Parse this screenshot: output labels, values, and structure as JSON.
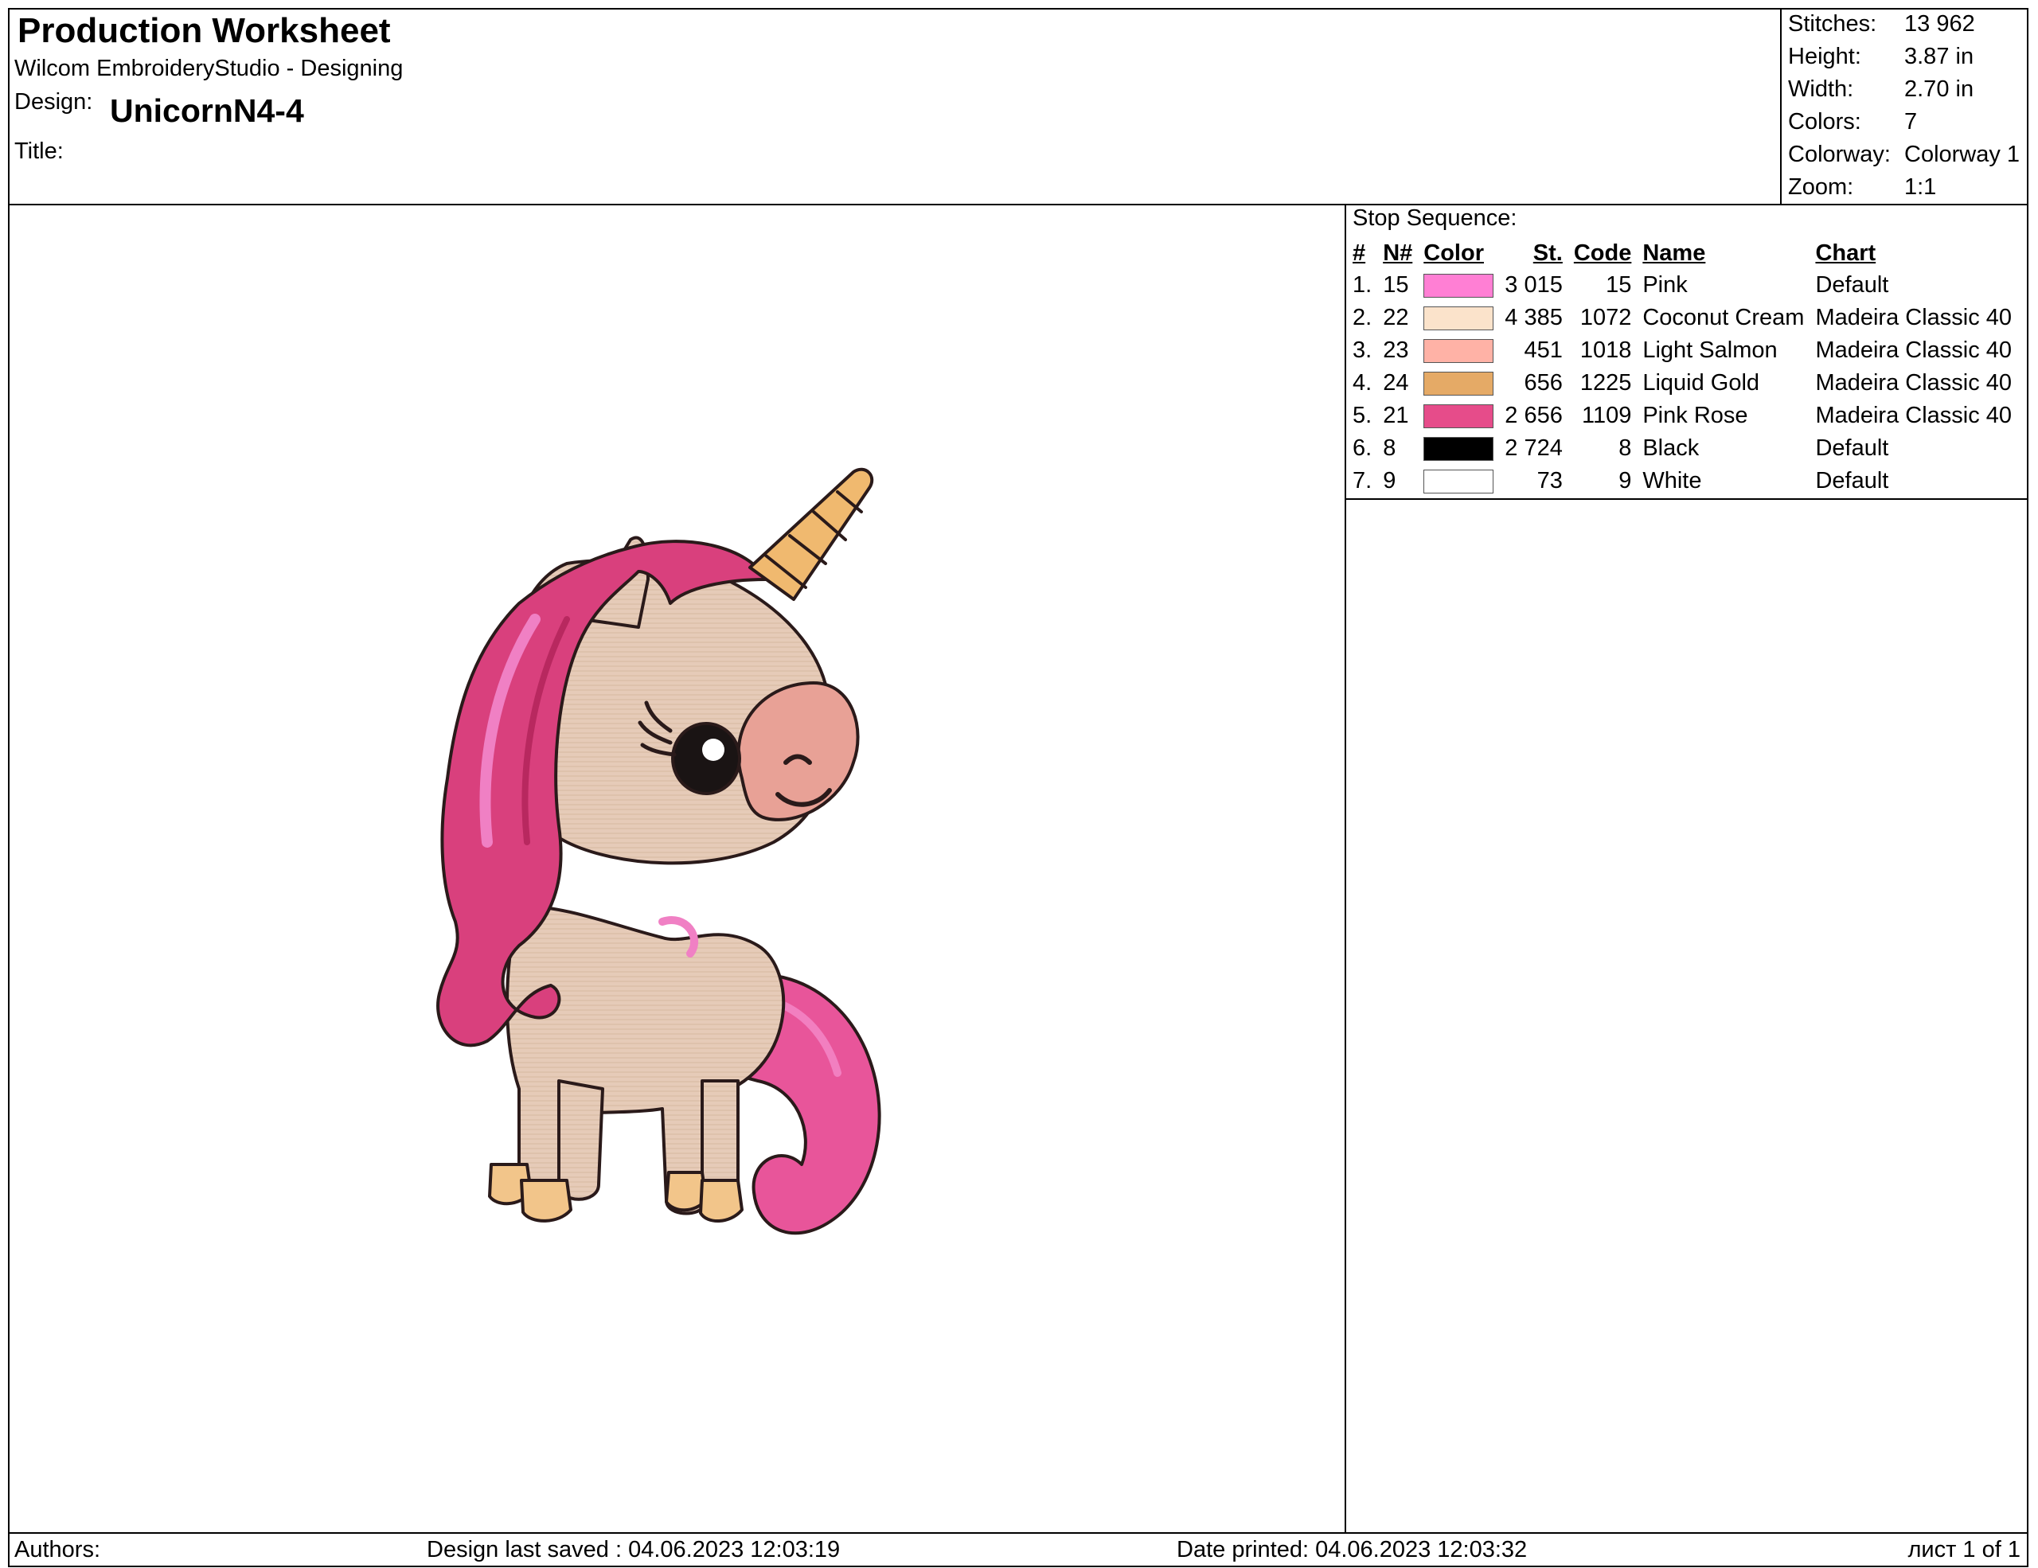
{
  "header": {
    "title": "Production Worksheet",
    "subtitle": "Wilcom EmbroideryStudio - Designing",
    "design_label": "Design:",
    "design_value": "UnicornN4-4",
    "title_label": "Title:"
  },
  "stats": [
    {
      "label": "Stitches:",
      "value": "13 962"
    },
    {
      "label": "Height:",
      "value": "3.87 in"
    },
    {
      "label": "Width:",
      "value": "2.70 in"
    },
    {
      "label": "Colors:",
      "value": "7"
    },
    {
      "label": "Colorway:",
      "value": "Colorway 1"
    },
    {
      "label": "Zoom:",
      "value": "1:1"
    }
  ],
  "stop_sequence": {
    "title": "Stop Sequence:",
    "columns": [
      "#",
      "N#",
      "Color",
      "St.",
      "Code",
      "Name",
      "Chart"
    ],
    "rows": [
      {
        "idx": "1.",
        "n": "15",
        "color": "#FF7FD4",
        "stitches": "3 015",
        "code": "15",
        "name": "Pink",
        "chart": "Default"
      },
      {
        "idx": "2.",
        "n": "22",
        "color": "#FBE3CB",
        "stitches": "4 385",
        "code": "1072",
        "name": "Coconut Cream",
        "chart": "Madeira Classic 40"
      },
      {
        "idx": "3.",
        "n": "23",
        "color": "#FFB2A6",
        "stitches": "451",
        "code": "1018",
        "name": "Light Salmon",
        "chart": "Madeira Classic 40"
      },
      {
        "idx": "4.",
        "n": "24",
        "color": "#E5AA66",
        "stitches": "656",
        "code": "1225",
        "name": "Liquid Gold",
        "chart": "Madeira Classic 40"
      },
      {
        "idx": "5.",
        "n": "21",
        "color": "#E64C8A",
        "stitches": "2 656",
        "code": "1109",
        "name": "Pink Rose",
        "chart": "Madeira Classic 40"
      },
      {
        "idx": "6.",
        "n": "8",
        "color": "#000000",
        "stitches": "2 724",
        "code": "8",
        "name": "Black",
        "chart": "Default"
      },
      {
        "idx": "7.",
        "n": "9",
        "color": "#FFFFFF",
        "stitches": "73",
        "code": "9",
        "name": "White",
        "chart": "Default"
      }
    ]
  },
  "footer": {
    "authors": "Authors:",
    "last_saved": "Design last saved : 04.06.2023 12:03:19",
    "printed": "Date printed: 04.06.2023 12:03:32",
    "page": "лист 1 of 1"
  }
}
